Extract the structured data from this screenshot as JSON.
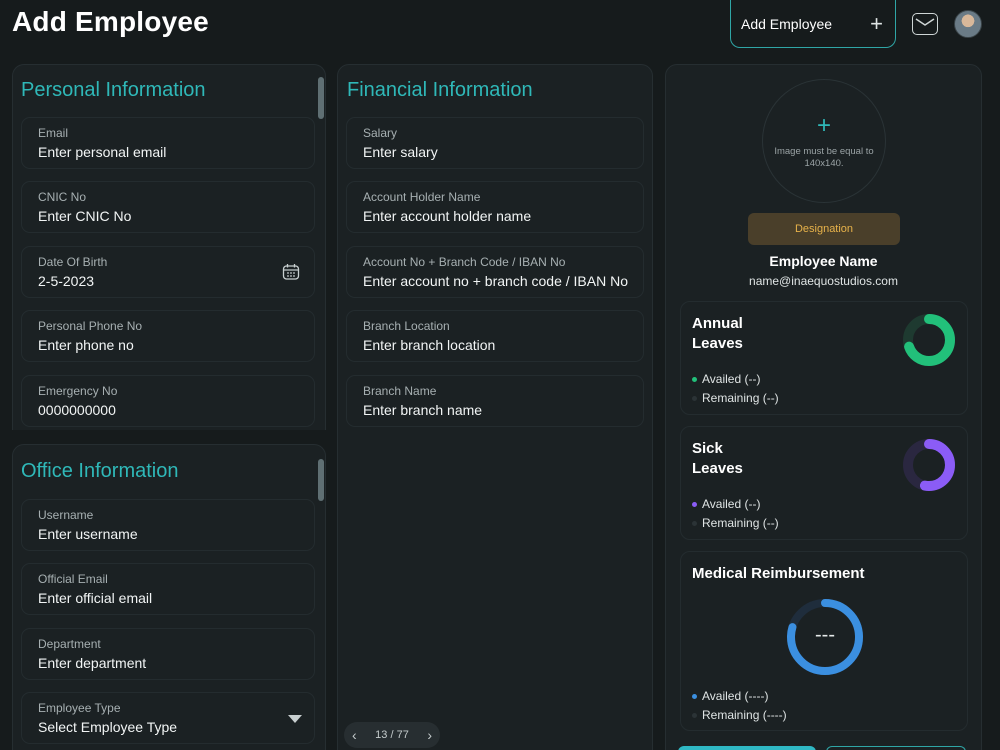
{
  "header": {
    "title": "Add Employee",
    "add_button_label": "Add Employee",
    "add_button_icon": "+"
  },
  "personal": {
    "title": "Personal Information",
    "fields": [
      {
        "label": "Email",
        "value": "Enter personal email"
      },
      {
        "label": "CNIC No",
        "value": "Enter CNIC No"
      },
      {
        "label": "Date Of Birth",
        "value": "2-5-2023"
      },
      {
        "label": "Personal Phone No",
        "value": "Enter phone no"
      },
      {
        "label": "Emergency No",
        "value": "0000000000"
      }
    ]
  },
  "office": {
    "title": "Office Information",
    "fields": [
      {
        "label": "Username",
        "value": "Enter username"
      },
      {
        "label": "Official Email",
        "value": "Enter official email"
      },
      {
        "label": "Department",
        "value": "Enter department"
      },
      {
        "label": "Employee Type",
        "value": "Select Employee Type"
      }
    ]
  },
  "financial": {
    "title": "Financial Information",
    "fields": [
      {
        "label": "Salary",
        "value": "Enter salary"
      },
      {
        "label": "Account Holder Name",
        "value": "Enter account holder name"
      },
      {
        "label": "Account No + Branch Code / IBAN No",
        "value": "Enter account no + branch code / IBAN No"
      },
      {
        "label": "Branch Location",
        "value": "Enter branch location"
      },
      {
        "label": "Branch Name",
        "value": "Enter branch name"
      }
    ]
  },
  "pager": {
    "text": "13 / 77"
  },
  "profile": {
    "photo_plus": "+",
    "photo_note": "Image must be equal to 140x140.",
    "designation": "Designation",
    "name": "Employee Name",
    "email": "name@inaequostudios.com"
  },
  "leaves": {
    "annual": {
      "title_line1": "Annual",
      "title_line2": "Leaves",
      "availed": "Availed (--)",
      "remaining": "Remaining (--)",
      "color": "#22c07a"
    },
    "sick": {
      "title_line1": "Sick",
      "title_line2": "Leaves",
      "availed": "Availed (--)",
      "remaining": "Remaining (--)",
      "color": "#8b5cf6"
    },
    "medical": {
      "title": "Medical Reimbursement",
      "center": "---",
      "availed": "Availed (----)",
      "remaining": "Remaining (----)",
      "color": "#3b8fe0"
    }
  }
}
